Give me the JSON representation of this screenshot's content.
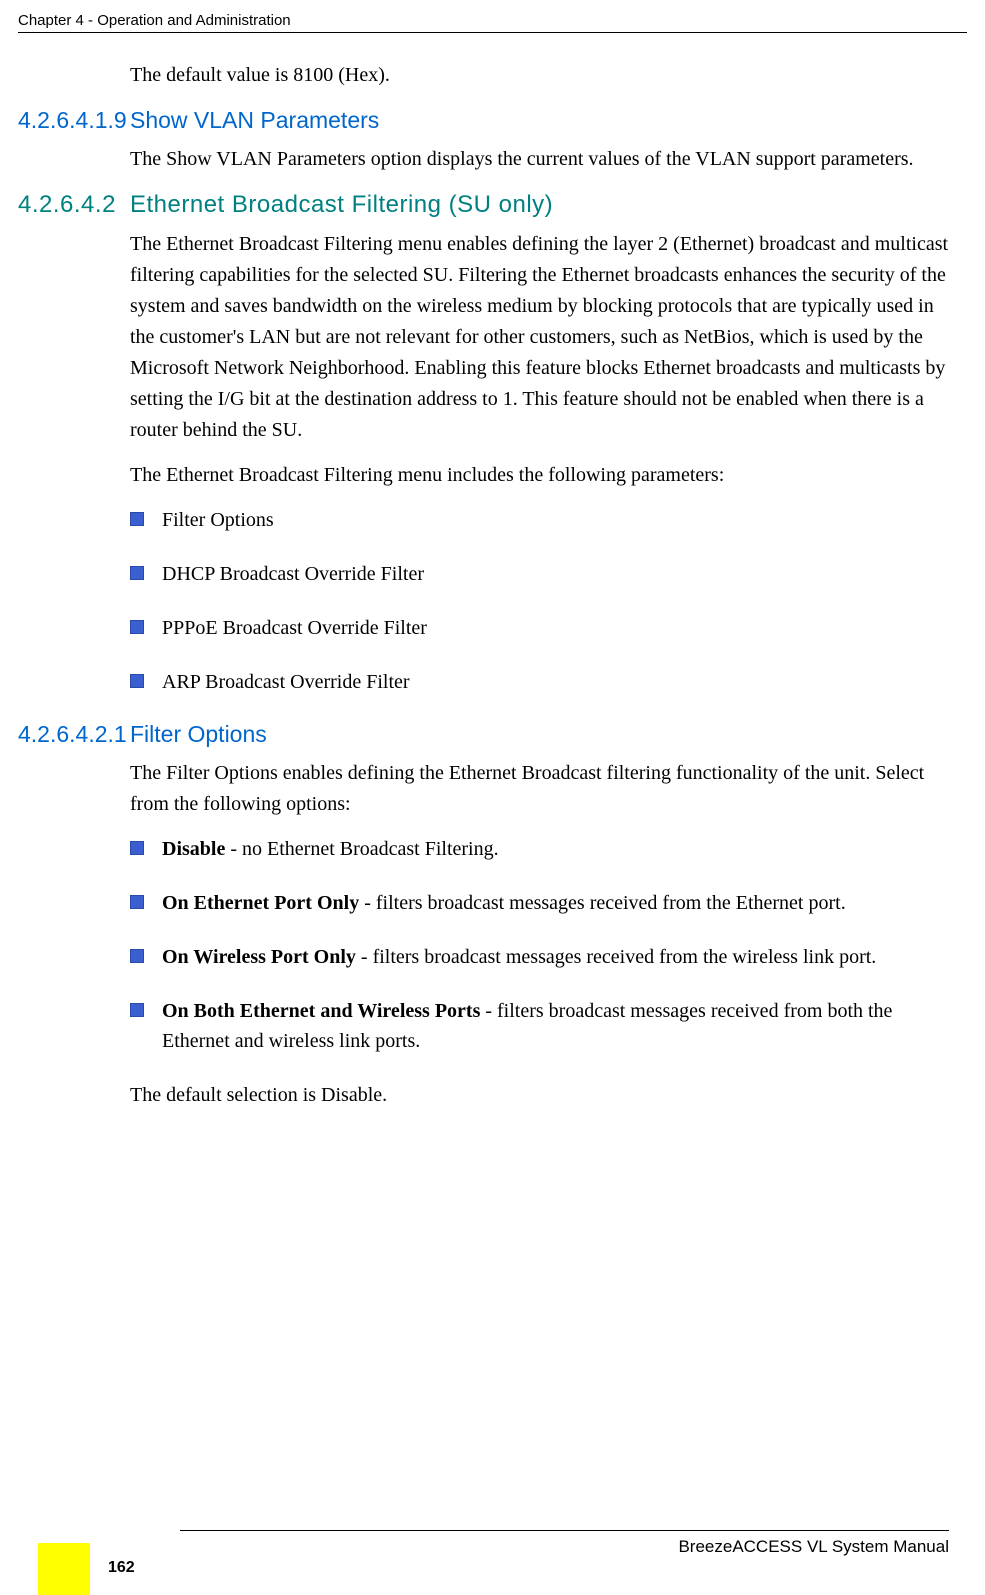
{
  "header": {
    "chapter": "Chapter 4 - Operation and Administration"
  },
  "intro": {
    "default_hex": "The default value is 8100 (Hex)."
  },
  "sec_show_vlan": {
    "num": "4.2.6.4.1.9",
    "title": "Show VLAN Parameters",
    "body": "The Show VLAN Parameters option displays the current values of the VLAN support parameters."
  },
  "sec_ebf": {
    "num": "4.2.6.4.2",
    "title": "Ethernet Broadcast Filtering (SU only)",
    "p1": "The Ethernet Broadcast Filtering menu enables defining the layer 2 (Ethernet) broadcast and multicast filtering capabilities for the selected SU. Filtering the Ethernet broadcasts enhances the security of the system and saves bandwidth on the wireless medium by blocking protocols that are typically used in the customer's LAN but are not relevant for other customers, such as NetBios, which is used by the Microsoft Network Neighborhood. Enabling this feature blocks Ethernet broadcasts and multicasts by setting the I/G bit at the destination address to 1. This feature should not be enabled when there is a router behind the SU.",
    "p2": "The Ethernet Broadcast Filtering menu includes the following parameters:",
    "items": [
      "Filter Options",
      "DHCP Broadcast Override Filter",
      "PPPoE Broadcast Override Filter",
      "ARP Broadcast Override Filter"
    ]
  },
  "sec_filter_options": {
    "num": "4.2.6.4.2.1",
    "title": "Filter Options",
    "p1": "The Filter Options enables defining the Ethernet Broadcast filtering functionality of the unit. Select from the following options:",
    "opts": [
      {
        "label": "Disable",
        "desc": " - no Ethernet Broadcast Filtering."
      },
      {
        "label": "On Ethernet Port Only",
        "desc": " - filters broadcast messages received from the Ethernet port."
      },
      {
        "label": "On Wireless Port Only",
        "desc": " - filters broadcast messages received from the wireless link port."
      },
      {
        "label": "On Both Ethernet and Wireless Ports",
        "desc": " - filters broadcast messages received from both the Ethernet and wireless link ports."
      }
    ],
    "p2": "The default selection is Disable."
  },
  "footer": {
    "manual": "BreezeACCESS VL System Manual",
    "page": "162"
  }
}
